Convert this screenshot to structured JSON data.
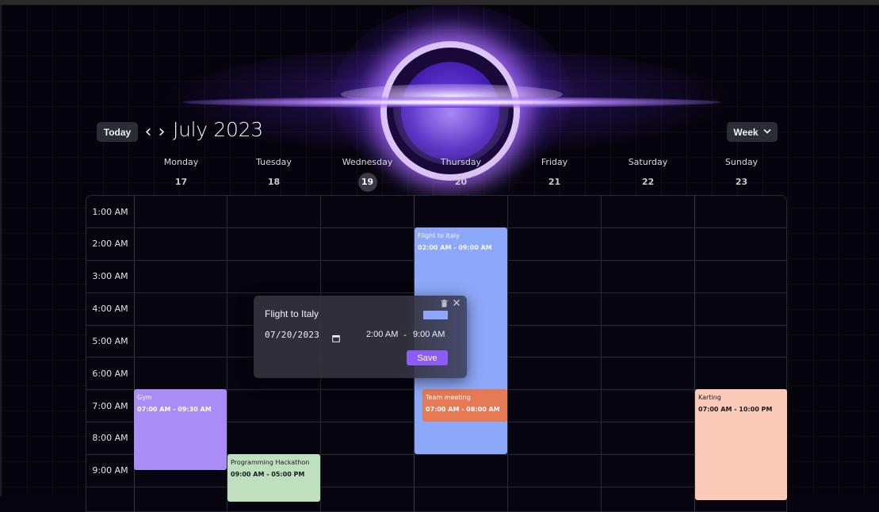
{
  "header": {
    "today_label": "Today",
    "prev_icon": "chevron-left-icon",
    "next_icon": "chevron-right-icon",
    "month_title": "July 2023",
    "view_label": "Week",
    "view_icon": "chevron-down-icon"
  },
  "days": [
    {
      "name": "Monday",
      "num": "17"
    },
    {
      "name": "Tuesday",
      "num": "18"
    },
    {
      "name": "Wednesday",
      "num": "19",
      "today": true
    },
    {
      "name": "Thursday",
      "num": "20"
    },
    {
      "name": "Friday",
      "num": "21"
    },
    {
      "name": "Saturday",
      "num": "22"
    },
    {
      "name": "Sunday",
      "num": "23"
    }
  ],
  "times": [
    "1:00 AM",
    "2:00 AM",
    "3:00 AM",
    "4:00 AM",
    "5:00 AM",
    "6:00 AM",
    "7:00 AM",
    "8:00 AM",
    "9:00 AM"
  ],
  "events": [
    {
      "title": "Flight to Italy",
      "time": "02:00 AM - 09:00 AM",
      "day": 3,
      "start": 2,
      "end": 9,
      "color": "#8da8f8",
      "text_color": "#f4f6ff"
    },
    {
      "title": "Gym",
      "time": "07:00 AM - 09:30 AM",
      "day": 0,
      "start": 7,
      "end": 9.5,
      "color": "#a98cf5",
      "text_color": "#ffffff"
    },
    {
      "title": "Team meeting",
      "time": "07:00 AM - 08:00 AM",
      "day": 3,
      "start": 7,
      "end": 8,
      "color": "#e57a54",
      "text_color": "#ffffff",
      "inset": true
    },
    {
      "title": "Karting",
      "time": "07:00 AM - 10:00 PM",
      "day": 6,
      "start": 7,
      "end": 22,
      "color": "#fccab8",
      "text_color": "#1b1b1b"
    },
    {
      "title": "Programming Hackathon",
      "time": "09:00 AM - 05:00 PM",
      "day": 1,
      "start": 9,
      "end": 17,
      "color": "#bfe0bf",
      "text_color": "#1b1b1b"
    }
  ],
  "popup": {
    "title": "Flight to Italy",
    "date": "07/20/2023",
    "start_time": "2:00 AM",
    "dash": "-",
    "end_time": "9:00 AM",
    "save_label": "Save",
    "color": "#8da8f8",
    "trash_icon": "trash-icon",
    "close_icon": "close-icon",
    "calendar_icon": "calendar-icon"
  }
}
